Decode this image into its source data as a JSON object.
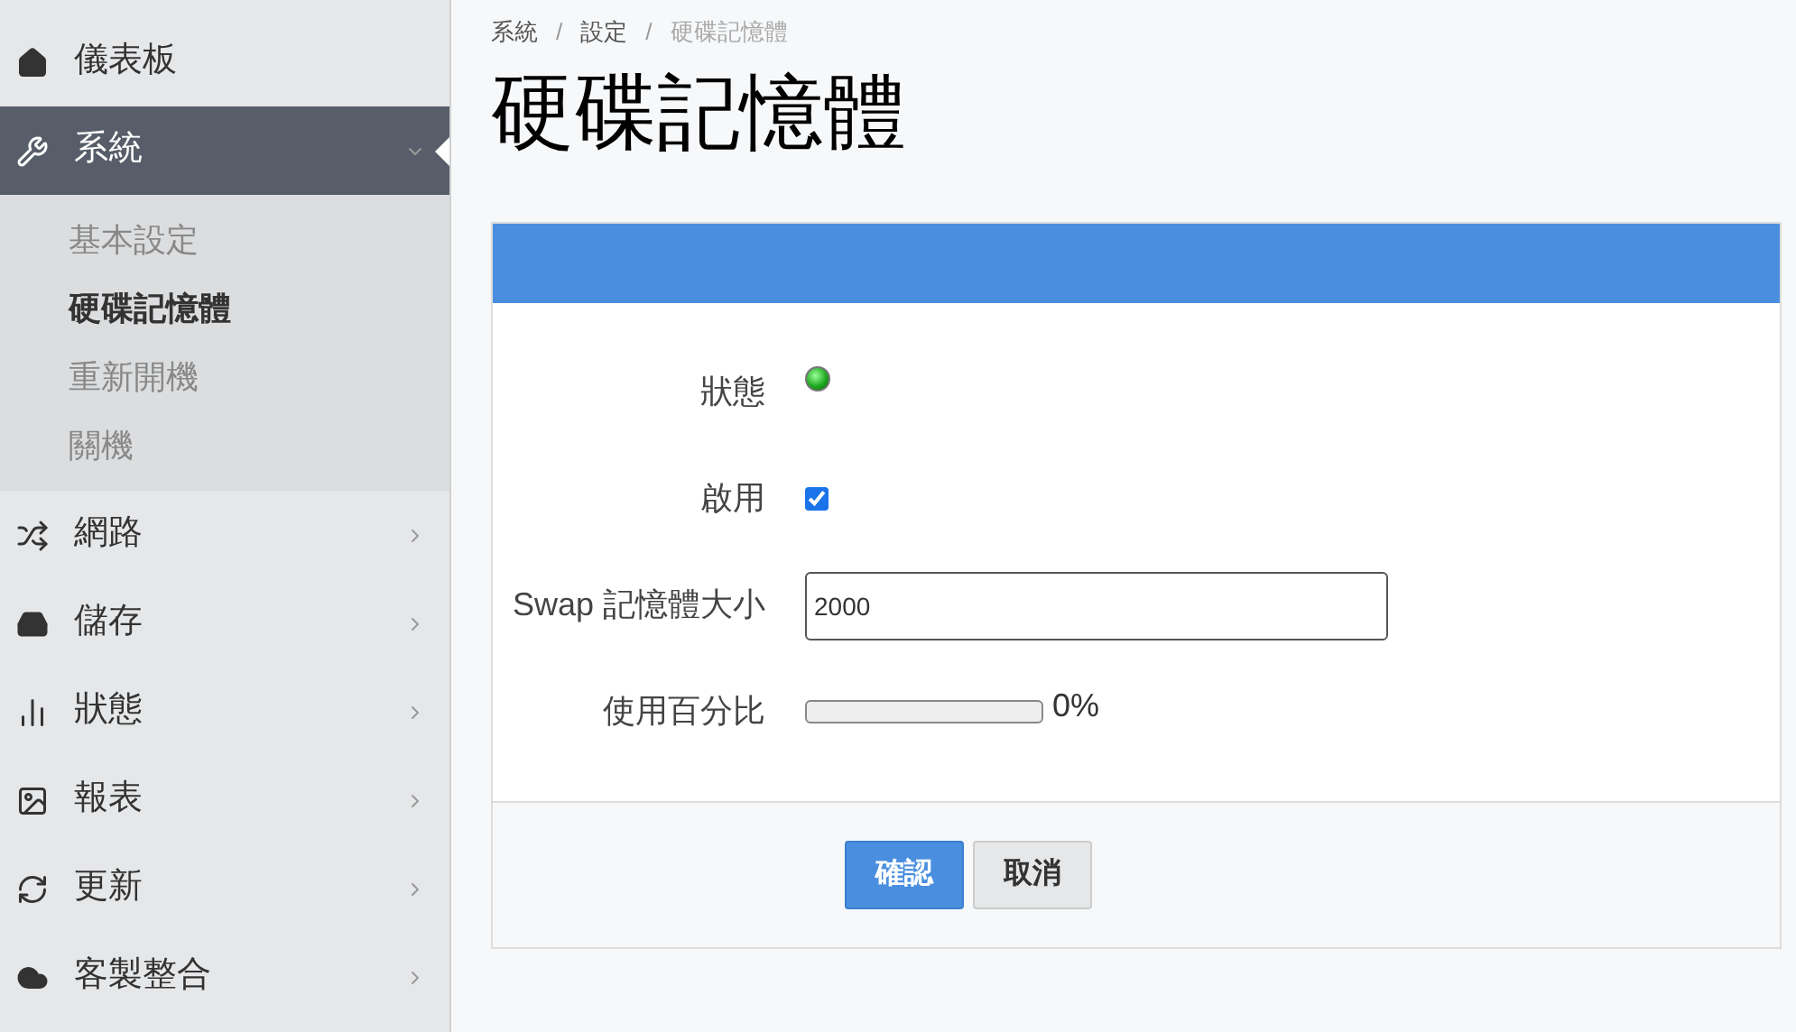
{
  "sidebar": {
    "items": [
      {
        "label": "儀表板",
        "selected": false
      },
      {
        "label": "系統",
        "selected": true,
        "expanded": true,
        "children": [
          {
            "label": "基本設定",
            "selected": false
          },
          {
            "label": "硬碟記憶體",
            "selected": true
          },
          {
            "label": "重新開機",
            "selected": false
          },
          {
            "label": "關機",
            "selected": false
          }
        ]
      },
      {
        "label": "網路",
        "selected": false,
        "expanded": false
      },
      {
        "label": "儲存",
        "selected": false,
        "expanded": false
      },
      {
        "label": "狀態",
        "selected": false,
        "expanded": false
      },
      {
        "label": "報表",
        "selected": false,
        "expanded": false
      },
      {
        "label": "更新",
        "selected": false,
        "expanded": false
      },
      {
        "label": "客製整合",
        "selected": false,
        "expanded": false
      }
    ]
  },
  "breadcrumb": [
    "系統",
    "設定",
    "硬碟記憶體"
  ],
  "breadcrumb_separator": "/",
  "title": "硬碟記憶體",
  "form": {
    "fields": [
      {
        "kind": "status",
        "label": "狀態",
        "on": true
      },
      {
        "kind": "checkbox",
        "label": "啟用",
        "checked": true
      },
      {
        "kind": "input",
        "label": "Swap 記憶體大小",
        "value": "2000"
      },
      {
        "kind": "progress",
        "label": "使用百分比",
        "level": 0,
        "reading": "0%"
      }
    ]
  },
  "buttons": [
    {
      "label": "確認",
      "kind": "primary"
    },
    {
      "label": "取消",
      "kind": "default"
    }
  ]
}
